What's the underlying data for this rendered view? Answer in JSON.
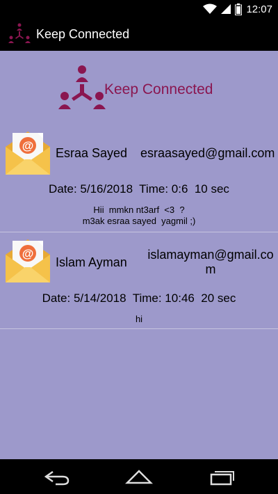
{
  "status_bar": {
    "time": "12:07"
  },
  "action_bar": {
    "title": "Keep Connected",
    "logo_icon": "network-people-icon"
  },
  "header": {
    "title": "Keep Connected",
    "logo_icon": "network-people-icon"
  },
  "messages": [
    {
      "sender": "Esraa Sayed",
      "email": "esraasayed@gmail.com",
      "datetime": "Date: 5/16/2018  Time: 0:6  10 sec",
      "body": "Hii  mmkn nt3arf  <3  ?\nm3ak esraa sayed  yagmil ;)",
      "icon": "email-envelope-icon"
    },
    {
      "sender": "Islam Ayman",
      "email": "islamayman@gmail.com",
      "datetime": "Date: 5/14/2018  Time: 10:46  20 sec",
      "body": "hi",
      "icon": "email-envelope-icon"
    }
  ],
  "colors": {
    "background": "#9d99cb",
    "accent": "#8a1650",
    "bar": "#000000",
    "envelope": "#f5c24a"
  },
  "nav_bar": {
    "icons": [
      "back-icon",
      "home-icon",
      "recent-apps-icon"
    ]
  }
}
